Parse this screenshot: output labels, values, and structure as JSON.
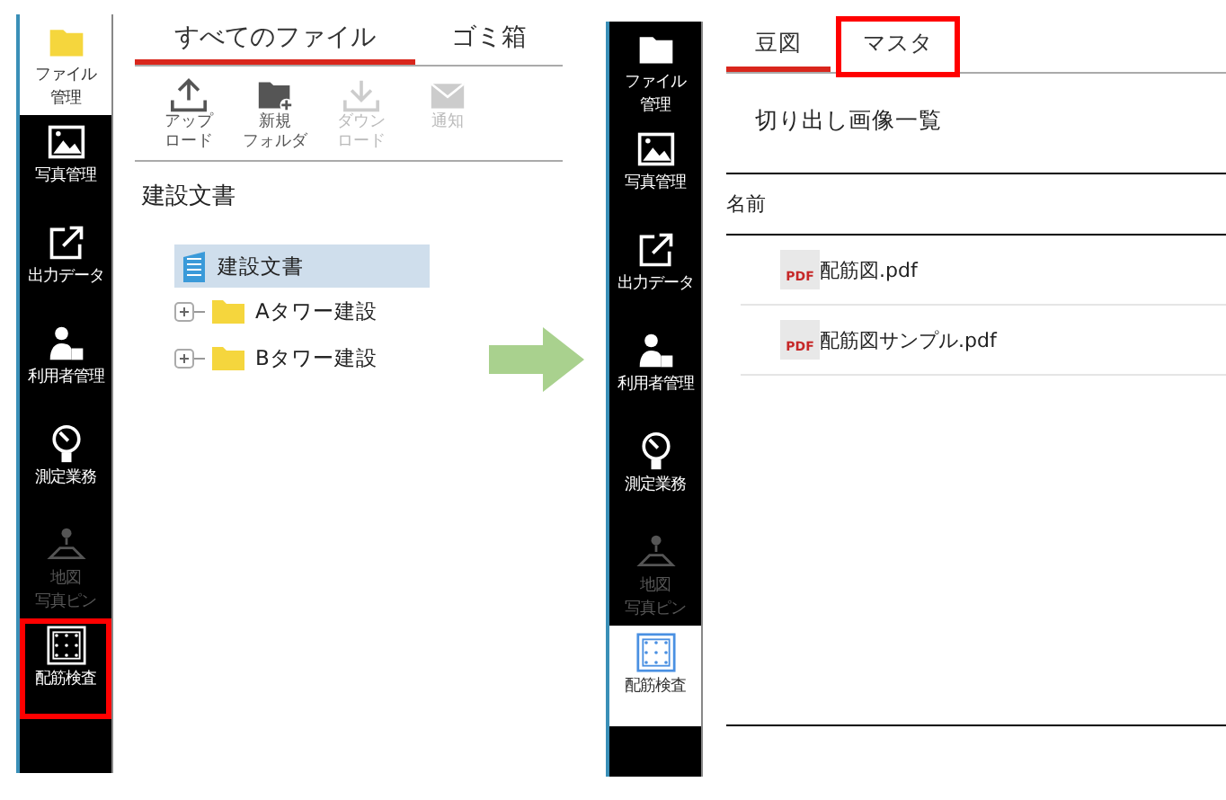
{
  "left_screen": {
    "sidebar": [
      {
        "lines": [
          "ファイル",
          "管理"
        ],
        "selected": true,
        "disabled": false,
        "highlighted": false
      },
      {
        "lines": [
          "写真管理"
        ],
        "selected": false,
        "disabled": false,
        "highlighted": false
      },
      {
        "lines": [
          "出力データ"
        ],
        "selected": false,
        "disabled": false,
        "highlighted": false
      },
      {
        "lines": [
          "利用者管理"
        ],
        "selected": false,
        "disabled": false,
        "highlighted": false
      },
      {
        "lines": [
          "測定業務"
        ],
        "selected": false,
        "disabled": false,
        "highlighted": false
      },
      {
        "lines": [
          "地図",
          "写真ピン"
        ],
        "selected": false,
        "disabled": true,
        "highlighted": false
      },
      {
        "lines": [
          "配筋検査"
        ],
        "selected": false,
        "disabled": false,
        "highlighted": true
      }
    ],
    "tabs": [
      {
        "label": "すべてのファイル",
        "selected": true
      },
      {
        "label": "ゴミ箱",
        "selected": false
      }
    ],
    "toolbar": [
      {
        "lines": [
          "アップ",
          "ロード"
        ],
        "disabled": false
      },
      {
        "lines": [
          "新規",
          "フォルダ"
        ],
        "disabled": false
      },
      {
        "lines": [
          "ダウン",
          "ロード"
        ],
        "disabled": true
      },
      {
        "lines": [
          "通知"
        ],
        "disabled": true
      }
    ],
    "folder_title": "建設文書",
    "tree": [
      {
        "label": "建設文書",
        "selected": true,
        "children": [
          {
            "label": "Aタワー建設",
            "selected": false,
            "expanded": false
          },
          {
            "label": "Bタワー建設",
            "selected": false,
            "expanded": false
          }
        ]
      }
    ]
  },
  "right_screen": {
    "sidebar": [
      {
        "lines": [
          "ファイル",
          "管理"
        ],
        "selected": false,
        "disabled": false,
        "highlighted": false
      },
      {
        "lines": [
          "写真管理"
        ],
        "selected": false,
        "disabled": false,
        "highlighted": false
      },
      {
        "lines": [
          "出力データ"
        ],
        "selected": false,
        "disabled": false,
        "highlighted": false
      },
      {
        "lines": [
          "利用者管理"
        ],
        "selected": false,
        "disabled": false,
        "highlighted": false
      },
      {
        "lines": [
          "測定業務"
        ],
        "selected": false,
        "disabled": false,
        "highlighted": false
      },
      {
        "lines": [
          "地図",
          "写真ピン"
        ],
        "selected": false,
        "disabled": true,
        "highlighted": false
      },
      {
        "lines": [
          "配筋検査"
        ],
        "selected": true,
        "disabled": false,
        "highlighted": false
      }
    ],
    "tabs": [
      {
        "label": "豆図",
        "selected": true,
        "highlighted": false
      },
      {
        "label": "マスタ",
        "selected": false,
        "highlighted": true
      }
    ],
    "heading": "切り出し画像一覧",
    "table": {
      "columns": [
        "名前"
      ],
      "rows": [
        {
          "badge": "PDF",
          "name": "配筋図.pdf"
        },
        {
          "badge": "PDF",
          "name": "配筋図サンプル.pdf"
        }
      ]
    }
  }
}
